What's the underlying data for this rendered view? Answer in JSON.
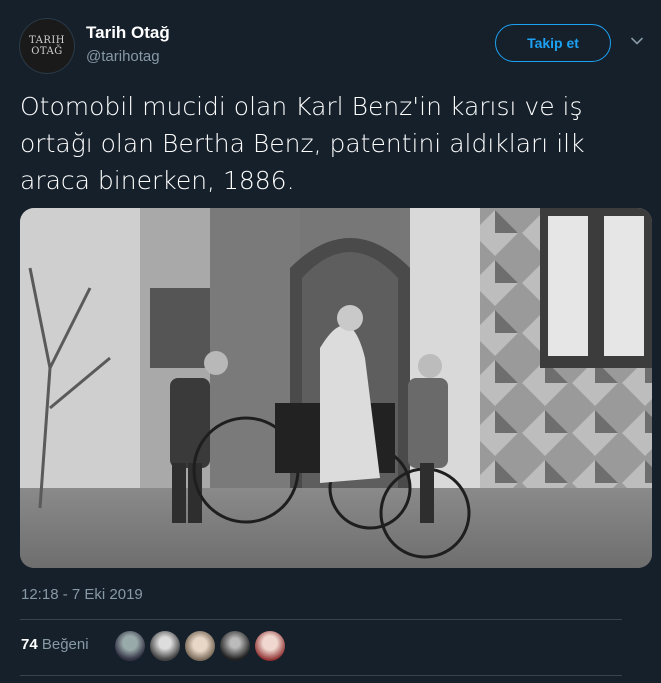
{
  "author": {
    "name": "Tarih Otağ",
    "handle": "@tarihotag",
    "avatar_text_line1": "TARIH",
    "avatar_text_line2": "OTAĞ"
  },
  "follow_button_label": "Takip et",
  "tweet": {
    "text": "Otomobil mucidi olan Karl Benz'in karısı ve iş ortağı olan Bertha Benz, patentini aldıkları ilk araca binerken, 1886.",
    "timestamp": "12:18 - 7 Eki 2019"
  },
  "engagement": {
    "likes_count": "74",
    "likes_label": "Beğeni",
    "likers": [
      "liker-1",
      "liker-2",
      "liker-3",
      "liker-4",
      "liker-5"
    ]
  },
  "colors": {
    "background": "#15202b",
    "accent": "#1da1f2",
    "secondary_text": "#8899a6",
    "divider": "#38444d"
  },
  "icons": {
    "more_menu": "chevron-down-icon"
  }
}
